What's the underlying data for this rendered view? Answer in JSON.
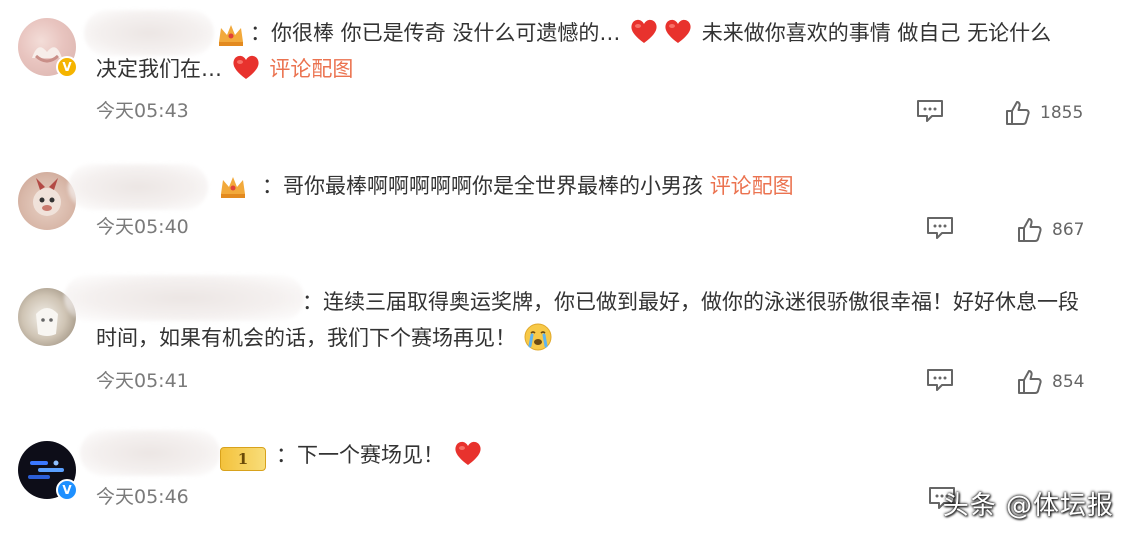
{
  "comments": [
    {
      "text_line1_a": "：你很棒 你已是传奇 没什么可遗憾的…",
      "text_line1_b": " 未来做你喜欢的事情 做自己 无论什么",
      "text_line2_a": "决定我们在…",
      "link": "评论配图",
      "time": "今天05:43",
      "likes": "1855"
    },
    {
      "text_line1_a": "：哥你最棒啊啊啊啊啊你是全世界最棒的小男孩",
      "link": "评论配图",
      "time": "今天05:40",
      "likes": "867"
    },
    {
      "text_line1_a": "：连续三届取得奥运奖牌，你已做到最好，做你的泳迷很骄傲很幸福！好好休息一段",
      "text_line2_a": "时间，如果有机会的话，我们下个赛场再见！",
      "time": "今天05:41",
      "likes": "854"
    },
    {
      "text_line1_a": "：下一个赛场见！",
      "badge_num": "1",
      "time": "今天05:46"
    }
  ],
  "watermark": "头条 @体坛报",
  "icons": {
    "heart": "heart-emoji-icon",
    "cry": "crying-emoji-icon",
    "crown": "crown-icon",
    "comment": "comment-icon",
    "like": "thumbs-up-icon",
    "verified": "verified-badge-icon"
  },
  "colors": {
    "link": "#eb7350",
    "time": "#7a7a7a",
    "heart": "#e8322d"
  }
}
